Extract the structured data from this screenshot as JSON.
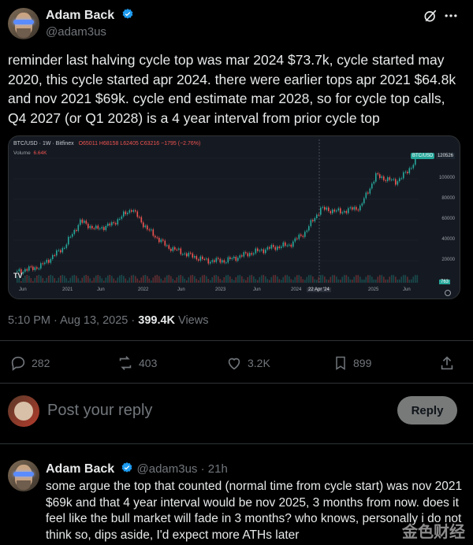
{
  "tweet": {
    "author": "Adam Back",
    "handle": "@adam3us",
    "text": "reminder last halving cycle top was mar 2024 $73.7k, cycle started may 2020, this cycle started apr 2024. there were earlier tops apr 2021 $64.8k and nov 2021 $69k. cycle end estimate mar 2028, so for cycle top calls, Q4 2027 (or Q1 2028) is a 4 year interval from prior cycle top",
    "time": "5:10 PM · Aug 13, 2025",
    "views_count": "399.4K",
    "views_label": "Views",
    "stats": {
      "replies": "282",
      "reposts": "403",
      "likes": "3.2K",
      "bookmarks": "899"
    }
  },
  "chart": {
    "symbol": "BTC/USD · 1W · Bitfinex",
    "ohlc": "O65011 H68158 L62405 C63216 −1795 (−2.76%)",
    "volume_label": "Volume",
    "volume_value": "6.64K",
    "last_price_tag": "BTC/USD",
    "last_price": "120526",
    "vol_tag": "763",
    "crosshair_date": "22 Apr '24",
    "y_ticks": [
      "100000",
      "80000",
      "60000",
      "40000",
      "20000"
    ],
    "x_ticks": [
      "Jun",
      "2021",
      "Jun",
      "2022",
      "Jun",
      "2023",
      "Jun",
      "2024",
      "2025",
      "Jun"
    ],
    "colors": {
      "up": "#26a69a",
      "down": "#ef5350",
      "bg": "#151a22"
    }
  },
  "reply_box": {
    "placeholder": "Post your reply",
    "button": "Reply"
  },
  "reply": {
    "author": "Adam Back",
    "handle": "@adam3us",
    "time": "· 21h",
    "text": "some argue the top that counted (normal time from cycle start) was nov 2021 $69k and that 4 year interval would be nov 2025, 3 months from now. does it feel like the bull market will fade in 3 months? who knows, personally i do not think so, dips aside, I'd expect more ATHs later"
  },
  "watermark": "金色财经"
}
